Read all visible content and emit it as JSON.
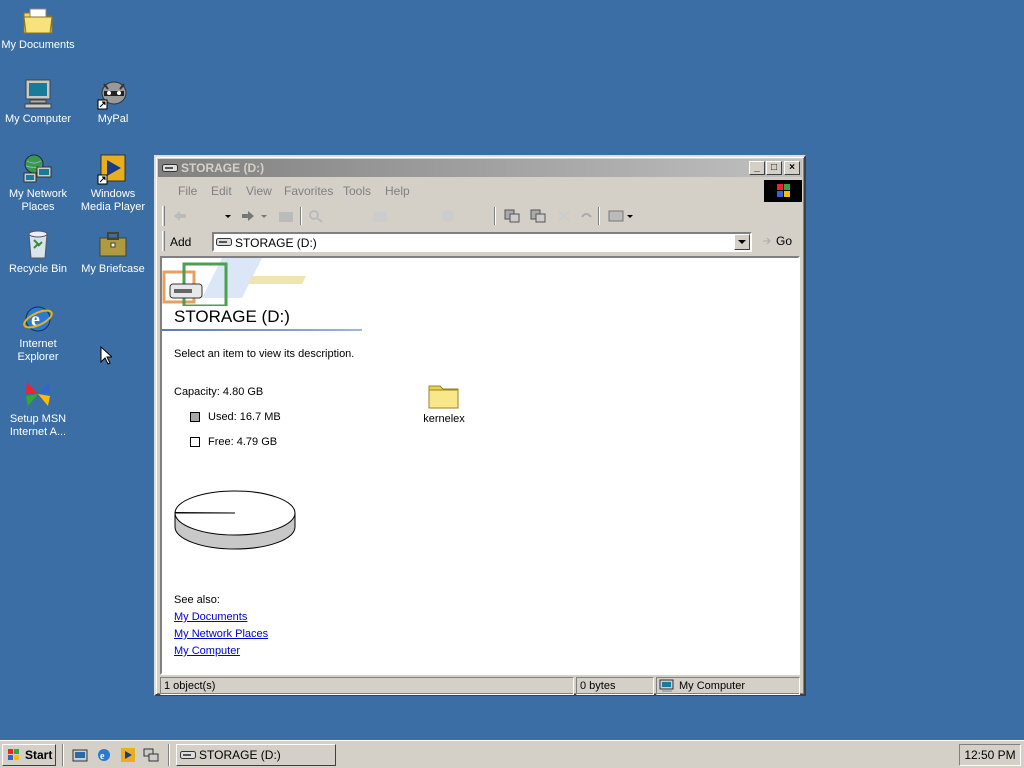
{
  "desktop": {
    "icons": [
      {
        "label": "My Documents",
        "icon": "folder-documents-icon"
      },
      {
        "label": "My Computer",
        "icon": "computer-icon"
      },
      {
        "label": "MyPal",
        "icon": "raccoon-shortcut-icon"
      },
      {
        "label": "My Network Places",
        "icon": "network-icon"
      },
      {
        "label": "Windows Media Player",
        "icon": "media-player-icon"
      },
      {
        "label": "Recycle Bin",
        "icon": "recycle-bin-icon"
      },
      {
        "label": "My Briefcase",
        "icon": "briefcase-icon"
      },
      {
        "label": "Internet Explorer",
        "icon": "ie-icon"
      },
      {
        "label": "Setup MSN Internet A...",
        "icon": "msn-butterfly-icon"
      }
    ]
  },
  "window": {
    "title": "STORAGE (D:)",
    "menu": [
      "File",
      "Edit",
      "View",
      "Favorites",
      "Tools",
      "Help"
    ],
    "address_label": "Add",
    "address_value": "STORAGE (D:)",
    "go_label": "Go",
    "heading": "STORAGE (D:)",
    "description": "Select an item to view its description.",
    "capacity": "Capacity: 4.80 GB",
    "used": "Used: 16.7 MB",
    "free": "Free: 4.79 GB",
    "used_fraction": 0.0034,
    "see_also": "See also:",
    "links": [
      "My Documents",
      "My Network Places",
      "My Computer"
    ],
    "files": [
      {
        "name": "kernelex",
        "icon": "folder-icon"
      }
    ],
    "status": {
      "objects": "1 object(s)",
      "size": "0 bytes",
      "zone": "My Computer"
    }
  },
  "taskbar": {
    "start": "Start",
    "task": "STORAGE (D:)",
    "clock": "12:50 PM"
  },
  "colors": {
    "desktop": "#3a6ea5",
    "chrome": "#d4d0c8",
    "link": "#0000cc"
  }
}
